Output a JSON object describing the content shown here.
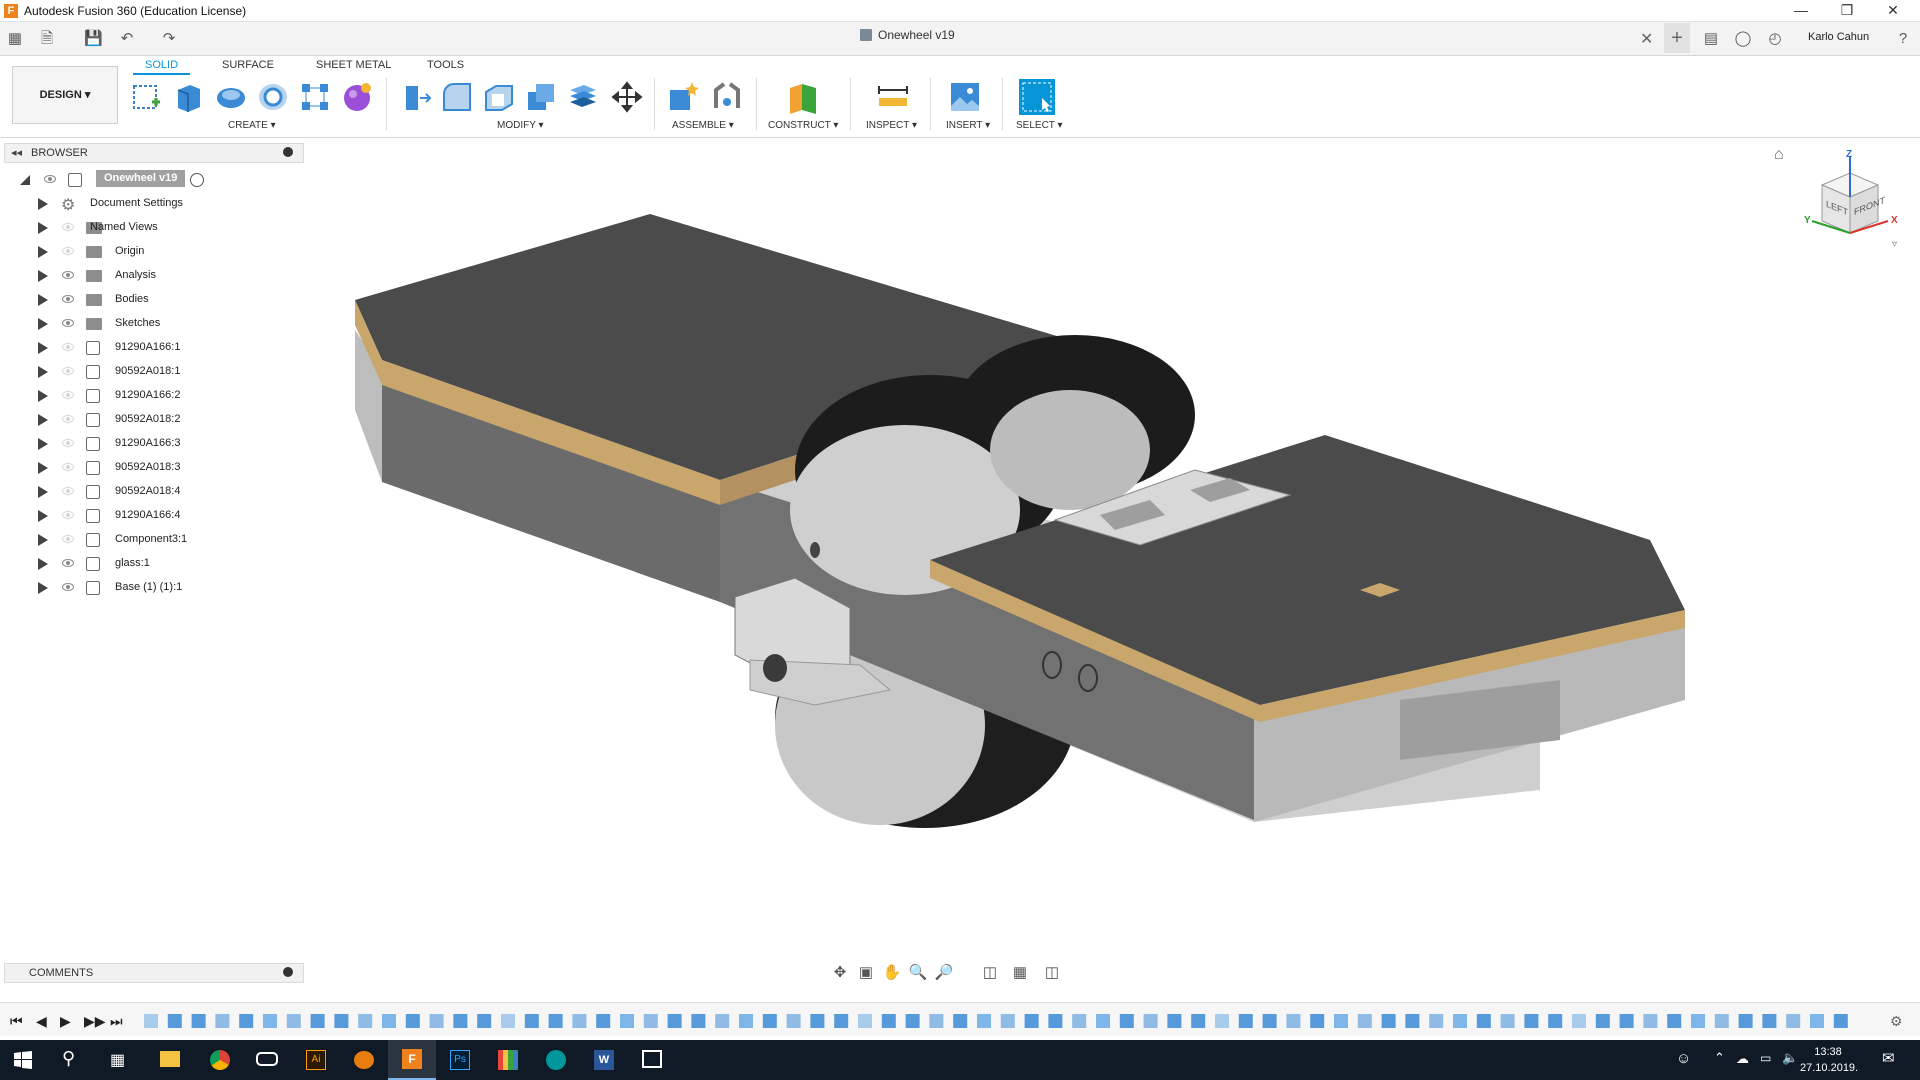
{
  "window": {
    "title": "Autodesk Fusion 360 (Education License)",
    "app_logo_letter": "F"
  },
  "quick_access": {
    "document_tab": "Onewheel v19",
    "user": "Karlo Cahun"
  },
  "ribbon": {
    "workspace": "DESIGN",
    "tabs": [
      "SOLID",
      "SURFACE",
      "SHEET METAL",
      "TOOLS"
    ],
    "groups": {
      "create": "CREATE",
      "modify": "MODIFY",
      "assemble": "ASSEMBLE",
      "construct": "CONSTRUCT",
      "inspect": "INSPECT",
      "insert": "INSERT",
      "select": "SELECT"
    }
  },
  "browser": {
    "title": "BROWSER",
    "root": "Onewheel v19",
    "items": [
      {
        "label": "Document Settings",
        "kind": "settings",
        "visible": false
      },
      {
        "label": "Named Views",
        "kind": "folder",
        "visible": false
      },
      {
        "label": "Origin",
        "kind": "folder",
        "visible": false
      },
      {
        "label": "Analysis",
        "kind": "folder",
        "visible": true
      },
      {
        "label": "Bodies",
        "kind": "folder",
        "visible": true
      },
      {
        "label": "Sketches",
        "kind": "folder",
        "visible": true
      },
      {
        "label": "91290A166:1",
        "kind": "component",
        "visible": false
      },
      {
        "label": "90592A018:1",
        "kind": "component",
        "visible": false
      },
      {
        "label": "91290A166:2",
        "kind": "component",
        "visible": false
      },
      {
        "label": "90592A018:2",
        "kind": "component",
        "visible": false
      },
      {
        "label": "91290A166:3",
        "kind": "component",
        "visible": false
      },
      {
        "label": "90592A018:3",
        "kind": "component",
        "visible": false
      },
      {
        "label": "90592A018:4",
        "kind": "component",
        "visible": false
      },
      {
        "label": "91290A166:4",
        "kind": "component",
        "visible": false
      },
      {
        "label": "Component3:1",
        "kind": "component",
        "visible": false
      },
      {
        "label": "glass:1",
        "kind": "component",
        "visible": true
      },
      {
        "label": "Base (1) (1):1",
        "kind": "component",
        "visible": true
      }
    ]
  },
  "viewcube": {
    "left": "LEFT",
    "front": "FRONT",
    "z": "Z",
    "x": "X",
    "y": "Y"
  },
  "comments": {
    "title": "COMMENTS"
  },
  "taskbar": {
    "time": "13:38",
    "date": "27.10.2019."
  },
  "colors": {
    "accent": "#0696d7",
    "deck": "#4a4a4a",
    "deck_edge": "#c9a66b",
    "frame": "#7d7d7d",
    "tire": "#1c1c1c",
    "taskbar": "#101a26"
  }
}
